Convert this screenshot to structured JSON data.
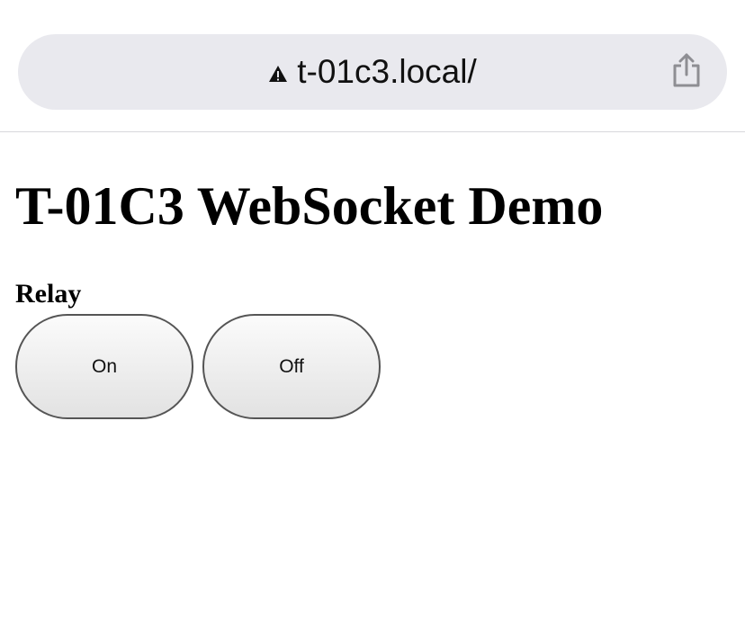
{
  "browser": {
    "url": "t-01c3.local/",
    "security_icon": "warning-triangle-icon",
    "share_icon": "share-icon"
  },
  "page": {
    "title": "T-01C3 WebSocket Demo",
    "relay": {
      "label": "Relay",
      "on_label": "On",
      "off_label": "Off"
    }
  },
  "colors": {
    "url_bar_bg": "#e9e9ee",
    "button_border": "#555555",
    "text": "#000000"
  }
}
